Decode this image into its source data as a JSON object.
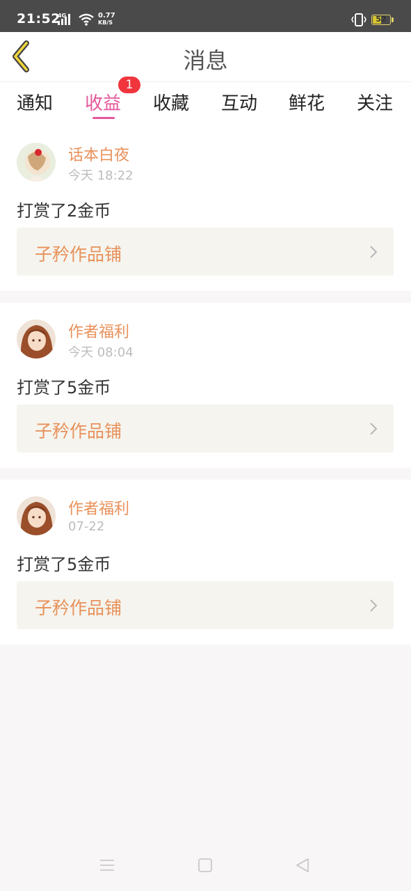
{
  "status_bar": {
    "time": "21:52",
    "network": "4G",
    "speed_value": "0.77",
    "speed_unit": "KB/S",
    "battery_level": 52,
    "battery_text": "52"
  },
  "header": {
    "title": "消息",
    "back_icon": "chevron-left-icon"
  },
  "tabs": {
    "items": [
      {
        "label": "通知"
      },
      {
        "label": "收益",
        "badge": "1",
        "active": true
      },
      {
        "label": "收藏"
      },
      {
        "label": "互动"
      },
      {
        "label": "鲜花"
      },
      {
        "label": "关注"
      }
    ]
  },
  "messages": [
    {
      "sender": "话本白夜",
      "time": "今天 18:22",
      "text": "打赏了2金币",
      "link_label": "子矜作品铺"
    },
    {
      "sender": "作者福利",
      "time": "今天 08:04",
      "text": "打赏了5金币",
      "link_label": "子矜作品铺"
    },
    {
      "sender": "作者福利",
      "time": "07-22",
      "text": "打赏了5金币",
      "link_label": "子矜作品铺"
    }
  ],
  "colors": {
    "accent": "#e5579a",
    "badge": "#f0353d",
    "name": "#e8915a",
    "link_bg": "#f5f4ee",
    "status_bar": "#4a4a4a"
  },
  "system_nav": {
    "menu_icon": "menu-icon",
    "home_icon": "home-square-icon",
    "back_icon": "back-triangle-icon"
  }
}
